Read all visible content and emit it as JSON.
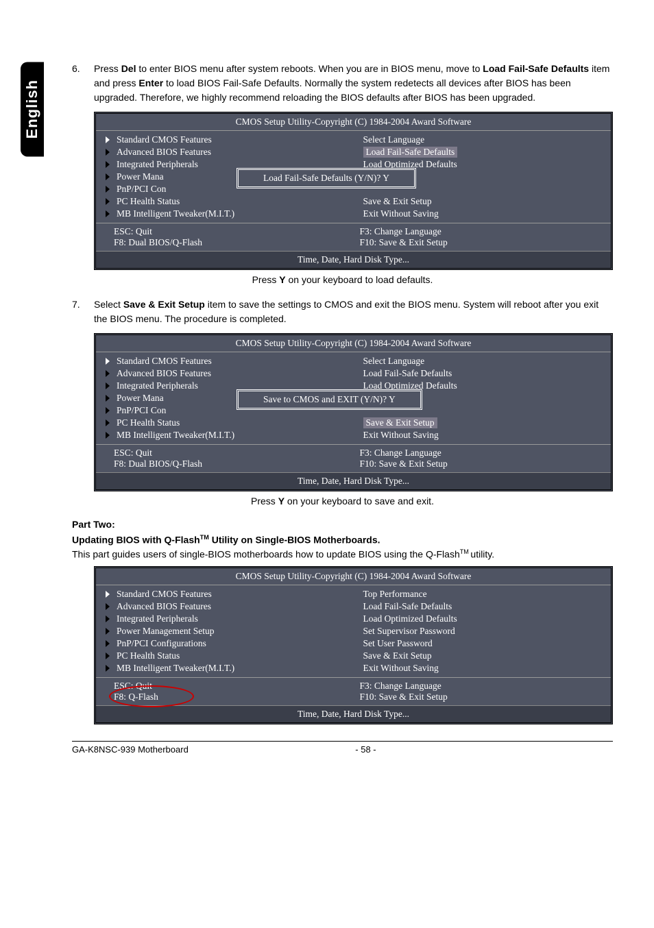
{
  "lang_tab": "English",
  "step6": {
    "num": "6.",
    "t1": "Press ",
    "b1": "Del",
    "t2": " to enter BIOS menu after system reboots. When you are in BIOS menu, move to ",
    "b2": "Load Fail-Safe Defaults",
    "t3": " item and press ",
    "b3": "Enter",
    "t4": " to load BIOS Fail-Safe Defaults. Normally the system redetects all devices after BIOS has been upgraded. Therefore, we highly recommend reloading the BIOS defaults after BIOS has been upgraded."
  },
  "bios1": {
    "title": "CMOS Setup Utility-Copyright (C) 1984-2004 Award Software",
    "left": [
      "Standard CMOS Features",
      "Advanced BIOS Features",
      "Integrated Peripherals",
      "Power Mana",
      "PnP/PCI Con",
      "PC Health Status",
      "MB Intelligent Tweaker(M.I.T.)"
    ],
    "right_top": [
      "Select Language"
    ],
    "right_hl": "Load Fail-Safe Defaults",
    "right_mid": [
      "Load Optimized Defaults"
    ],
    "right_bot": [
      "Save & Exit Setup",
      "Exit Without Saving"
    ],
    "dialog": "Load Fail-Safe Defaults (Y/N)? Y",
    "foot_l1": "ESC: Quit",
    "foot_l2": "F8: Dual BIOS/Q-Flash",
    "foot_r1": "F3: Change Language",
    "foot_r2": "F10: Save & Exit Setup",
    "hint": "Time, Date, Hard Disk Type..."
  },
  "caption1a": "Press ",
  "caption1b": "Y",
  "caption1c": " on your keyboard to load defaults.",
  "step7": {
    "num": "7.",
    "t1": "Select ",
    "b1": "Save & Exit Setup",
    "t2": " item to save the settings to CMOS and exit the BIOS menu. System will reboot after you exit the BIOS menu. The procedure is completed."
  },
  "bios2": {
    "title": "CMOS Setup Utility-Copyright (C) 1984-2004 Award Software",
    "left": [
      "Standard CMOS Features",
      "Advanced BIOS Features",
      "Integrated Peripherals",
      "Power Mana",
      "PnP/PCI Con",
      "PC Health Status",
      "MB Intelligent Tweaker(M.I.T.)"
    ],
    "right_top": [
      "Select Language",
      "Load Fail-Safe Defaults"
    ],
    "right_mid": [
      "Load Optimized Defaults"
    ],
    "right_hl": "Save & Exit Setup",
    "right_bot": [
      "Exit Without Saving"
    ],
    "dialog": "Save to CMOS and EXIT (Y/N)? Y",
    "foot_l1": "ESC: Quit",
    "foot_l2": "F8: Dual BIOS/Q-Flash",
    "foot_r1": "F3: Change Language",
    "foot_r2": "F10: Save & Exit Setup",
    "hint": "Time, Date, Hard Disk Type..."
  },
  "caption2a": "Press ",
  "caption2b": "Y",
  "caption2c": " on your keyboard to save and exit.",
  "part2_title": "Part Two:",
  "part2_sub_a": "Updating BIOS with Q-Flash",
  "part2_sub_tm": "TM",
  "part2_sub_b": " Utility on Single-BIOS Motherboards.",
  "part2_body_a": "This part guides users of single-BIOS motherboards how to update BIOS using the Q-Flash",
  "part2_body_tm": "TM ",
  "part2_body_b": "utility.",
  "bios3": {
    "title": "CMOS Setup Utility-Copyright (C) 1984-2004 Award Software",
    "left": [
      "Standard CMOS Features",
      "Advanced BIOS Features",
      "Integrated Peripherals",
      "Power Management Setup",
      "PnP/PCI Configurations",
      "PC Health Status",
      "MB Intelligent Tweaker(M.I.T.)"
    ],
    "right": [
      "Top Performance",
      "Load Fail-Safe Defaults",
      "Load Optimized Defaults",
      "Set Supervisor Password",
      "Set User Password",
      "Save & Exit Setup",
      "Exit Without Saving"
    ],
    "foot_l1": "ESC: Quit",
    "foot_l2": "F8: Q-Flash",
    "foot_r1": "F3: Change Language",
    "foot_r2": "F10: Save & Exit Setup",
    "hint": "Time, Date, Hard Disk Type..."
  },
  "footer_l": "GA-K8NSC-939 Motherboard",
  "footer_c": "- 58 -"
}
